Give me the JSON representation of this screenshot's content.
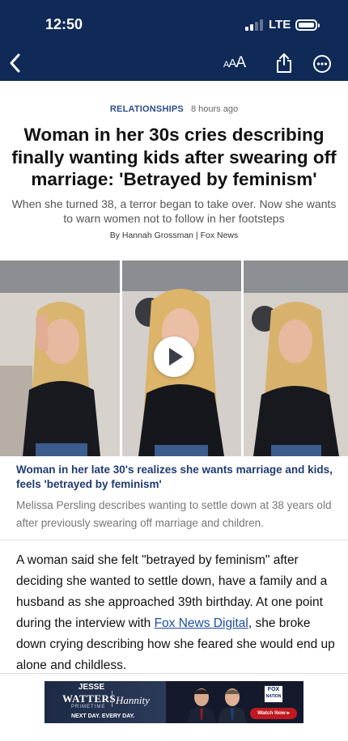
{
  "status_bar": {
    "time": "12:50",
    "network": "LTE",
    "signal_bars_on": 2,
    "signal_bars_total": 4
  },
  "nav": {
    "back_icon": "chevron-left-icon",
    "text_size": {
      "small": "A",
      "medium": "A",
      "large": "A"
    },
    "share_icon": "share-icon",
    "more_icon": "more-icon"
  },
  "article": {
    "category": "RELATIONSHIPS",
    "time_ago": "8 hours ago",
    "headline": "Woman in her 30s cries describing finally wanting kids after swearing off marriage: 'Betrayed by feminism'",
    "subhead": "When she turned 38, a terror began to take over. Now she wants to warn women not to follow in her footsteps",
    "byline": "By Hannah Grossman | Fox News",
    "video": {
      "caption_title": "Woman in her late 30's realizes she wants marriage and kids, feels 'betrayed by feminism'",
      "caption_desc": "Melissa Persling describes wanting to settle down at 38 years old after previously swearing off marriage and children."
    },
    "body": {
      "before_link": "A woman said she felt \"betrayed by feminism\" after deciding she wanted to settle down, have a family and a husband as she approached 39th birthday. At one point during the interview with ",
      "link": "Fox News Digital",
      "after_link": ", she broke down crying describing how she feared she would end up alone and childless."
    }
  },
  "ad": {
    "jesse": "JESSE",
    "watters": "WATTERS",
    "primetime": "PRIMETIME",
    "next_day": "NEXT DAY. EVERY DAY.",
    "hannity": "Hannity",
    "fox_line1": "FOX",
    "fox_line2": "NATION",
    "watch_now": "Watch Now ▸"
  },
  "colors": {
    "header_bg": "#0f2a57",
    "category": "#2c4d8a",
    "caption_title": "#1f3a73",
    "link": "#1d4fa3"
  }
}
